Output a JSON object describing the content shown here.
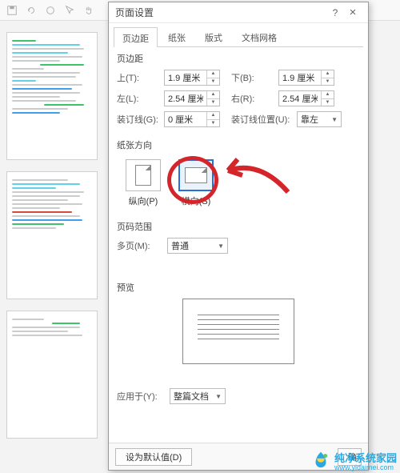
{
  "toolbar": {
    "icons": [
      "save-icon",
      "undo-icon",
      "redo-icon",
      "arrow-icon",
      "hand-icon"
    ]
  },
  "dialog": {
    "title": "页面设置",
    "help": "?",
    "close": "×",
    "tabs": [
      "页边距",
      "纸张",
      "版式",
      "文档网格"
    ],
    "margins": {
      "header": "页边距",
      "top_label": "上(T):",
      "top_val": "1.9 厘米",
      "bottom_label": "下(B):",
      "bottom_val": "1.9 厘米",
      "left_label": "左(L):",
      "left_val": "2.54 厘米",
      "right_label": "右(R):",
      "right_val": "2.54 厘米",
      "gutter_label": "装订线(G):",
      "gutter_val": "0 厘米",
      "gutter_pos_label": "装订线位置(U):",
      "gutter_pos_val": "靠左"
    },
    "orientation": {
      "header": "纸张方向",
      "portrait": "纵向(P)",
      "landscape": "横向(S)"
    },
    "pages": {
      "header": "页码范围",
      "multi_label": "多页(M):",
      "multi_val": "普通"
    },
    "preview": {
      "header": "预览"
    },
    "apply": {
      "label": "应用于(Y):",
      "val": "整篇文档"
    },
    "footer": {
      "default": "设为默认值(D)",
      "ok": "确"
    }
  },
  "watermark": {
    "brand": "纯净系统家园",
    "url": "www.yidaimei.com"
  }
}
